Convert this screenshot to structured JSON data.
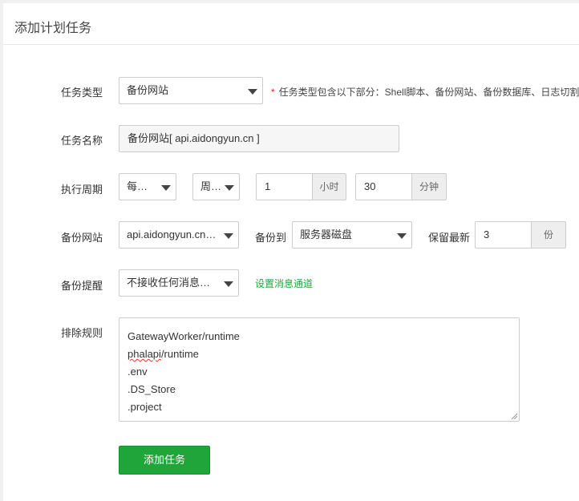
{
  "panel": {
    "title": "添加计划任务"
  },
  "form": {
    "task_type": {
      "label": "任务类型",
      "value": "备份网站",
      "hint_star": "*",
      "hint": "任务类型包含以下部分：Shell脚本、备份网站、备份数据库、日志切割"
    },
    "task_name": {
      "label": "任务名称",
      "value": "备份网站[ api.aidongyun.cn ]"
    },
    "cycle": {
      "label": "执行周期",
      "period": "每星期",
      "weekday": "周一",
      "hour": "1",
      "hour_unit": "小时",
      "minute": "30",
      "minute_unit": "分钟"
    },
    "backup_site": {
      "label": "备份网站",
      "site": "api.aidongyun.cn [ api.aidongyun.cn ]",
      "to_label": "备份到",
      "to": "服务器磁盘",
      "keep_label": "保留最新",
      "keep": "3",
      "keep_unit": "份"
    },
    "reminder": {
      "label": "备份提醒",
      "value": "不接收任何消息通知",
      "link": "设置消息通道"
    },
    "exclude": {
      "label": "排除规则",
      "lines": [
        "GatewayWorker/runtime",
        "phalapi",
        "/runtime",
        ".env",
        ".DS_Store",
        ".project"
      ]
    },
    "submit_label": "添加任务"
  }
}
